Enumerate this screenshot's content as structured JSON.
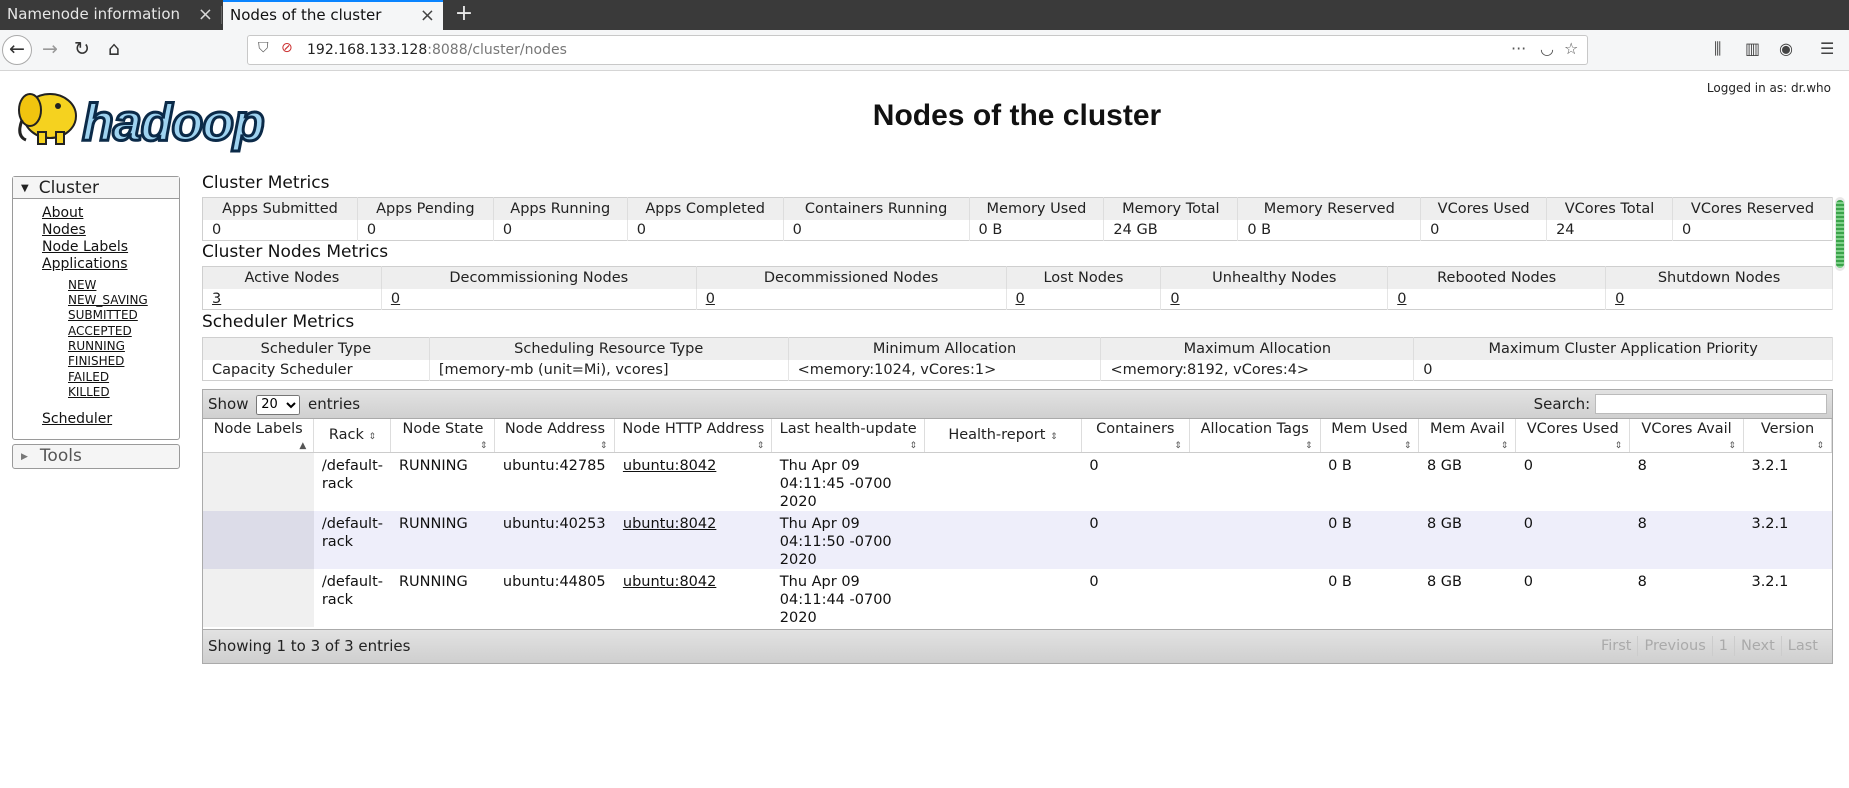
{
  "browser": {
    "tabs": [
      {
        "label": "Namenode information"
      },
      {
        "label": "Nodes of the cluster"
      }
    ],
    "url_host": "192.168.133.128",
    "url_rest": ":8088/cluster/nodes"
  },
  "header": {
    "title": "Nodes of the cluster",
    "logged_in": "Logged in as: dr.who"
  },
  "sidebar": {
    "cluster_label": "Cluster",
    "links": [
      "About",
      "Nodes",
      "Node Labels",
      "Applications"
    ],
    "app_states": [
      "NEW",
      "NEW_SAVING",
      "SUBMITTED",
      "ACCEPTED",
      "RUNNING",
      "FINISHED",
      "FAILED",
      "KILLED"
    ],
    "scheduler": "Scheduler",
    "tools_label": "Tools"
  },
  "cluster_metrics": {
    "title": "Cluster Metrics",
    "headers": [
      "Apps Submitted",
      "Apps Pending",
      "Apps Running",
      "Apps Completed",
      "Containers Running",
      "Memory Used",
      "Memory Total",
      "Memory Reserved",
      "VCores Used",
      "VCores Total",
      "VCores Reserved"
    ],
    "values": [
      "0",
      "0",
      "0",
      "0",
      "0",
      "0 B",
      "24 GB",
      "0 B",
      "0",
      "24",
      "0"
    ]
  },
  "nodes_metrics": {
    "title": "Cluster Nodes Metrics",
    "headers": [
      "Active Nodes",
      "Decommissioning Nodes",
      "Decommissioned Nodes",
      "Lost Nodes",
      "Unhealthy Nodes",
      "Rebooted Nodes",
      "Shutdown Nodes"
    ],
    "values": [
      "3",
      "0",
      "0",
      "0",
      "0",
      "0",
      "0"
    ]
  },
  "scheduler_metrics": {
    "title": "Scheduler Metrics",
    "headers": [
      "Scheduler Type",
      "Scheduling Resource Type",
      "Minimum Allocation",
      "Maximum Allocation",
      "Maximum Cluster Application Priority"
    ],
    "values": [
      "Capacity Scheduler",
      "[memory-mb (unit=Mi), vcores]",
      "<memory:1024, vCores:1>",
      "<memory:8192, vCores:4>",
      "0"
    ]
  },
  "nodes_table": {
    "show_label": "Show",
    "entries_value": "20",
    "entries_label": "entries",
    "search_label": "Search:",
    "columns": [
      "Node Labels",
      "Rack",
      "Node State",
      "Node Address",
      "Node HTTP Address",
      "Last health-update",
      "Health-report",
      "Containers",
      "Allocation Tags",
      "Mem Used",
      "Mem Avail",
      "VCores Used",
      "VCores Avail",
      "Version"
    ],
    "rows": [
      [
        "",
        "/default-rack",
        "RUNNING",
        "ubuntu:42785",
        "ubuntu:8042",
        "Thu Apr 09 04:11:45 -0700 2020",
        "",
        "0",
        "",
        "0 B",
        "8 GB",
        "0",
        "8",
        "3.2.1"
      ],
      [
        "",
        "/default-rack",
        "RUNNING",
        "ubuntu:40253",
        "ubuntu:8042",
        "Thu Apr 09 04:11:50 -0700 2020",
        "",
        "0",
        "",
        "0 B",
        "8 GB",
        "0",
        "8",
        "3.2.1"
      ],
      [
        "",
        "/default-rack",
        "RUNNING",
        "ubuntu:44805",
        "ubuntu:8042",
        "Thu Apr 09 04:11:44 -0700 2020",
        "",
        "0",
        "",
        "0 B",
        "8 GB",
        "0",
        "8",
        "3.2.1"
      ]
    ],
    "info": "Showing 1 to 3 of 3 entries",
    "pager": [
      "First",
      "Previous",
      "1",
      "Next",
      "Last"
    ]
  }
}
